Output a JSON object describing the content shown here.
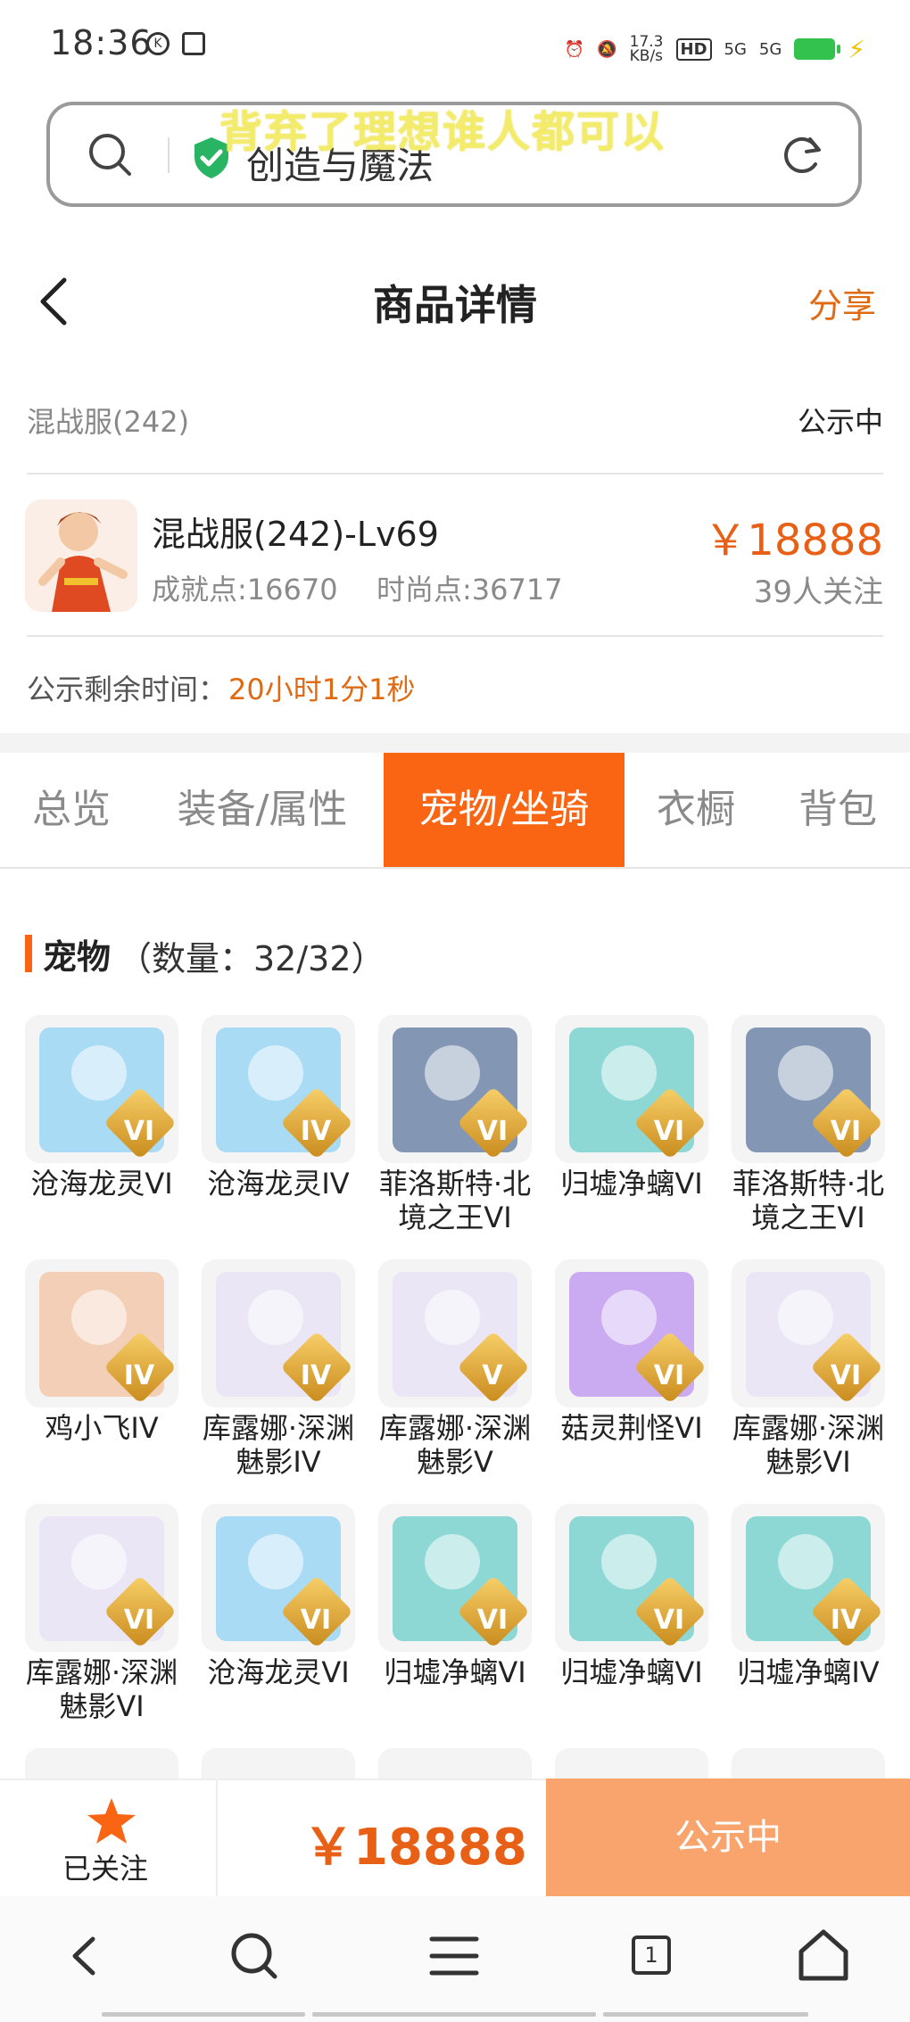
{
  "status_bar": {
    "time": "18:36",
    "net_speed": "17.3",
    "net_unit": "KB/s",
    "hd": "HD",
    "sig1": "5G",
    "sig2": "5G"
  },
  "search": {
    "overlay_text": "背弃了理想谁人都可以",
    "query": "创造与魔法"
  },
  "header": {
    "title": "商品详情",
    "share": "分享"
  },
  "server": {
    "name": "混战服(242)",
    "status": "公示中"
  },
  "product": {
    "title": "混战服(242)-Lv69",
    "achievement": "成就点:16670",
    "fashion": "时尚点:36717",
    "price": "￥18888",
    "followers": "39人关注"
  },
  "countdown": {
    "label": "公示剩余时间：",
    "value": "20小时1分1秒"
  },
  "tabs": [
    "总览",
    "装备/属性",
    "宠物/坐骑",
    "衣橱",
    "背包"
  ],
  "pets": {
    "title": "宠物",
    "count": "（数量：32/32）",
    "items": [
      {
        "name": "沧海龙灵VI",
        "badge": "VI",
        "color": "#9bd6f4"
      },
      {
        "name": "沧海龙灵IV",
        "badge": "IV",
        "color": "#9bd6f4"
      },
      {
        "name": "菲洛斯特·北境之王VI",
        "badge": "VI",
        "color": "#6f86a8"
      },
      {
        "name": "归墟净螭VI",
        "badge": "VI",
        "color": "#7ad2cf"
      },
      {
        "name": "菲洛斯特·北境之王VI",
        "badge": "VI",
        "color": "#6f86a8"
      },
      {
        "name": "鸡小飞IV",
        "badge": "IV",
        "color": "#f1c8aa"
      },
      {
        "name": "库露娜·深渊魅影IV",
        "badge": "IV",
        "color": "#e9e3f4"
      },
      {
        "name": "库露娜·深渊魅影V",
        "badge": "V",
        "color": "#e9e3f4"
      },
      {
        "name": "菇灵荆怪VI",
        "badge": "VI",
        "color": "#c29ef0"
      },
      {
        "name": "库露娜·深渊魅影VI",
        "badge": "VI",
        "color": "#e9e3f4"
      },
      {
        "name": "库露娜·深渊魅影VI",
        "badge": "VI",
        "color": "#e9e3f4"
      },
      {
        "name": "沧海龙灵VI",
        "badge": "VI",
        "color": "#9bd6f4"
      },
      {
        "name": "归墟净螭VI",
        "badge": "VI",
        "color": "#7ad2cf"
      },
      {
        "name": "归墟净螭VI",
        "badge": "VI",
        "color": "#7ad2cf"
      },
      {
        "name": "归墟净螭IV",
        "badge": "IV",
        "color": "#7ad2cf"
      }
    ]
  },
  "bottom": {
    "follow_label": "已关注",
    "price": "￥18888",
    "cta": "公示中"
  },
  "nav": {
    "tab_count": "1"
  },
  "colors": {
    "accent": "#fa6514",
    "price": "#e85f16",
    "cta": "#f9a46d"
  }
}
